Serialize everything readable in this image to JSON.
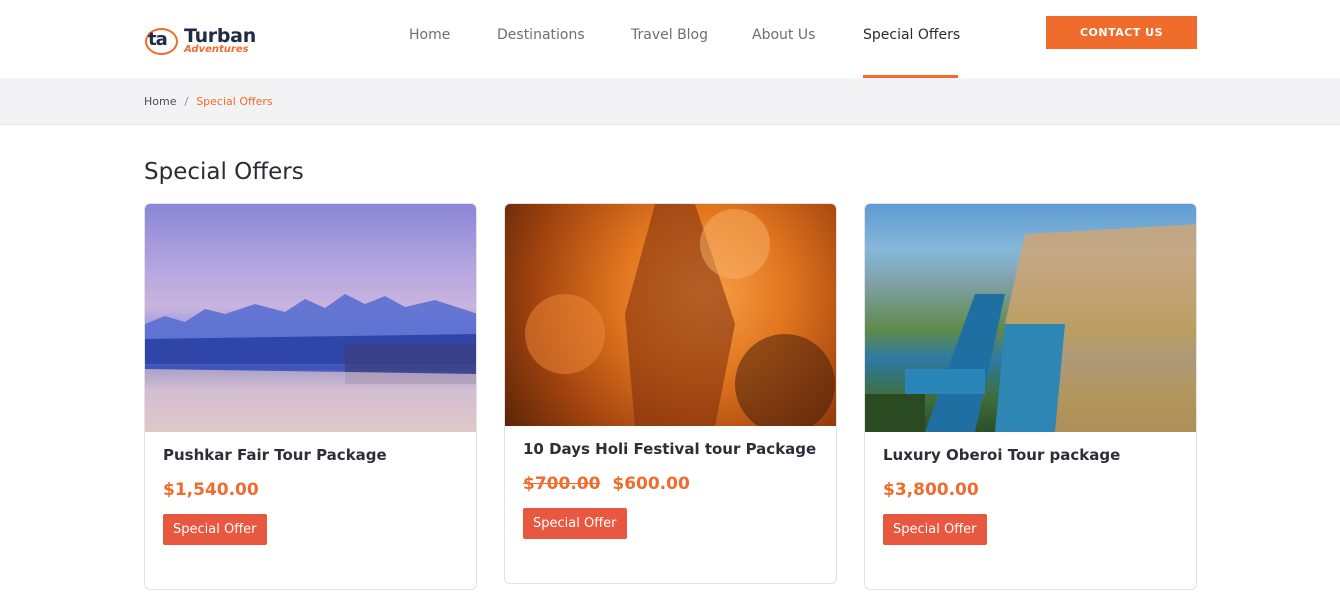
{
  "brand": {
    "name_line1": "Turban",
    "name_line2": "Adventures",
    "mark": "ta"
  },
  "nav": {
    "items": [
      {
        "label": "Home"
      },
      {
        "label": "Destinations"
      },
      {
        "label": "Travel Blog"
      },
      {
        "label": "About Us"
      },
      {
        "label": "Special Offers",
        "active": true
      }
    ],
    "cta_label": "CONTACT US"
  },
  "breadcrumb": {
    "home": "Home",
    "separator": "/",
    "current": "Special Offers"
  },
  "page_title": "Special Offers",
  "cards": [
    {
      "title": "Pushkar Fair Tour Package",
      "old_price": "",
      "price": "$1,540.00",
      "badge": "Special Offer"
    },
    {
      "title": "10 Days Holi Festival tour Package",
      "old_price": "$700.00",
      "price": "$600.00",
      "badge": "Special Offer"
    },
    {
      "title": "Luxury Oberoi Tour package",
      "old_price": "",
      "price": "$3,800.00",
      "badge": "Special Offer"
    }
  ],
  "colors": {
    "accent": "#ef6c2c",
    "badge": "#e8573f",
    "crumb_bg": "#f3f3f5"
  }
}
